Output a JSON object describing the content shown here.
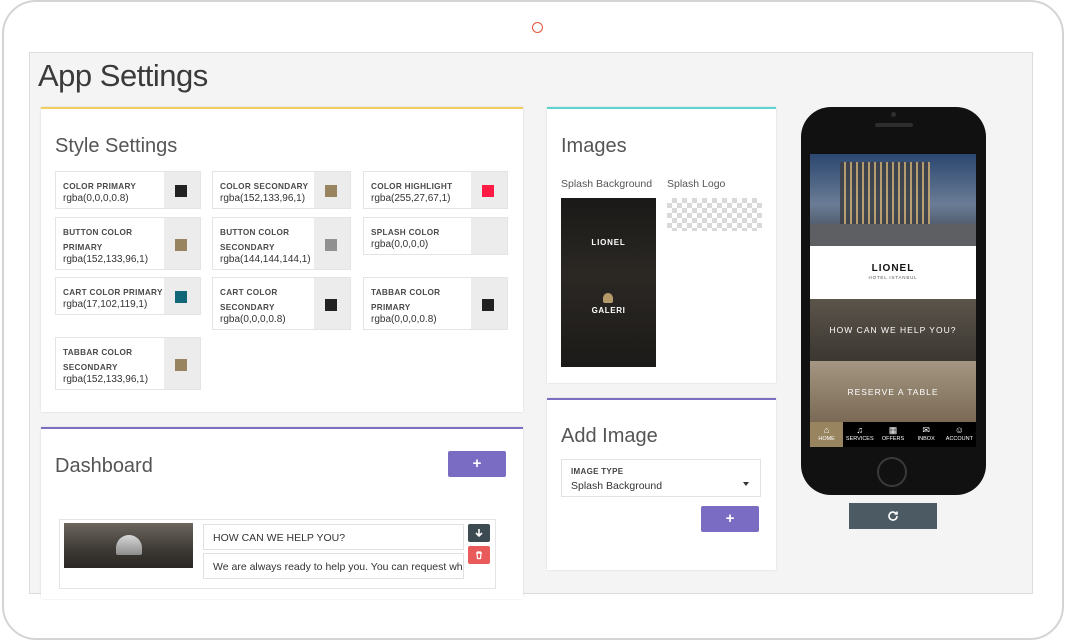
{
  "page": {
    "title": "App Settings"
  },
  "style_settings": {
    "title": "Style Settings",
    "colors": [
      {
        "label": "COLOR PRIMARY",
        "value": "rgba(0,0,0,0.8)",
        "swatch": "#222222"
      },
      {
        "label": "COLOR SECONDARY",
        "value": "rgba(152,133,96,1)",
        "swatch": "#988560"
      },
      {
        "label": "COLOR HIGHLIGHT",
        "value": "rgba(255,27,67,1)",
        "swatch": "#ff1b43"
      },
      {
        "label": "BUTTON COLOR PRIMARY",
        "value": "rgba(152,133,96,1)",
        "swatch": "#988560"
      },
      {
        "label": "BUTTON COLOR SECONDARY",
        "value": "rgba(144,144,144,1)",
        "swatch": "#909090"
      },
      {
        "label": "SPLASH COLOR",
        "value": "rgba(0,0,0,0)",
        "swatch": "transparent"
      },
      {
        "label": "CART COLOR PRIMARY",
        "value": "rgba(17,102,119,1)",
        "swatch": "#116677"
      },
      {
        "label": "CART COLOR SECONDARY",
        "value": "rgba(0,0,0,0.8)",
        "swatch": "#222222"
      },
      {
        "label": "TABBAR COLOR PRIMARY",
        "value": "rgba(0,0,0,0.8)",
        "swatch": "#222222"
      },
      {
        "label": "TABBAR COLOR SECONDARY",
        "value": "rgba(152,133,96,1)",
        "swatch": "#988560"
      }
    ]
  },
  "images": {
    "title": "Images",
    "splash_background_label": "Splash Background",
    "splash_logo_label": "Splash Logo",
    "splash_brand": "LIONEL",
    "splash_subbrand": "GALERI"
  },
  "add_image": {
    "title": "Add Image",
    "select_label": "IMAGE TYPE",
    "select_value": "Splash Background",
    "add_button": "+"
  },
  "dashboard": {
    "title": "Dashboard",
    "add_button": "+",
    "item": {
      "title": "HOW CAN WE HELP YOU?",
      "description": "We are always ready to help you. You can request wh"
    }
  },
  "phone_preview": {
    "brand": "LIONEL",
    "brand_sub": "HOTEL ISTANBUL",
    "tile1": "HOW CAN WE HELP YOU?",
    "tile2": "RESERVE A TABLE",
    "tabs": [
      {
        "label": "HOME",
        "icon": "home-icon",
        "glyph": "⌂"
      },
      {
        "label": "SERVICES",
        "icon": "bell-icon",
        "glyph": "♫"
      },
      {
        "label": "OFFERS",
        "icon": "gift-icon",
        "glyph": "▦"
      },
      {
        "label": "INBOX",
        "icon": "mail-icon",
        "glyph": "✉"
      },
      {
        "label": "ACCOUNT",
        "icon": "user-icon",
        "glyph": "☺"
      }
    ],
    "active_tab_color": "#988560",
    "refresh_icon": "refresh-icon"
  },
  "colors": {
    "accent_yellow": "#f3cd5d",
    "accent_teal": "#5fd3cf",
    "accent_purple": "#7b6cc3"
  }
}
